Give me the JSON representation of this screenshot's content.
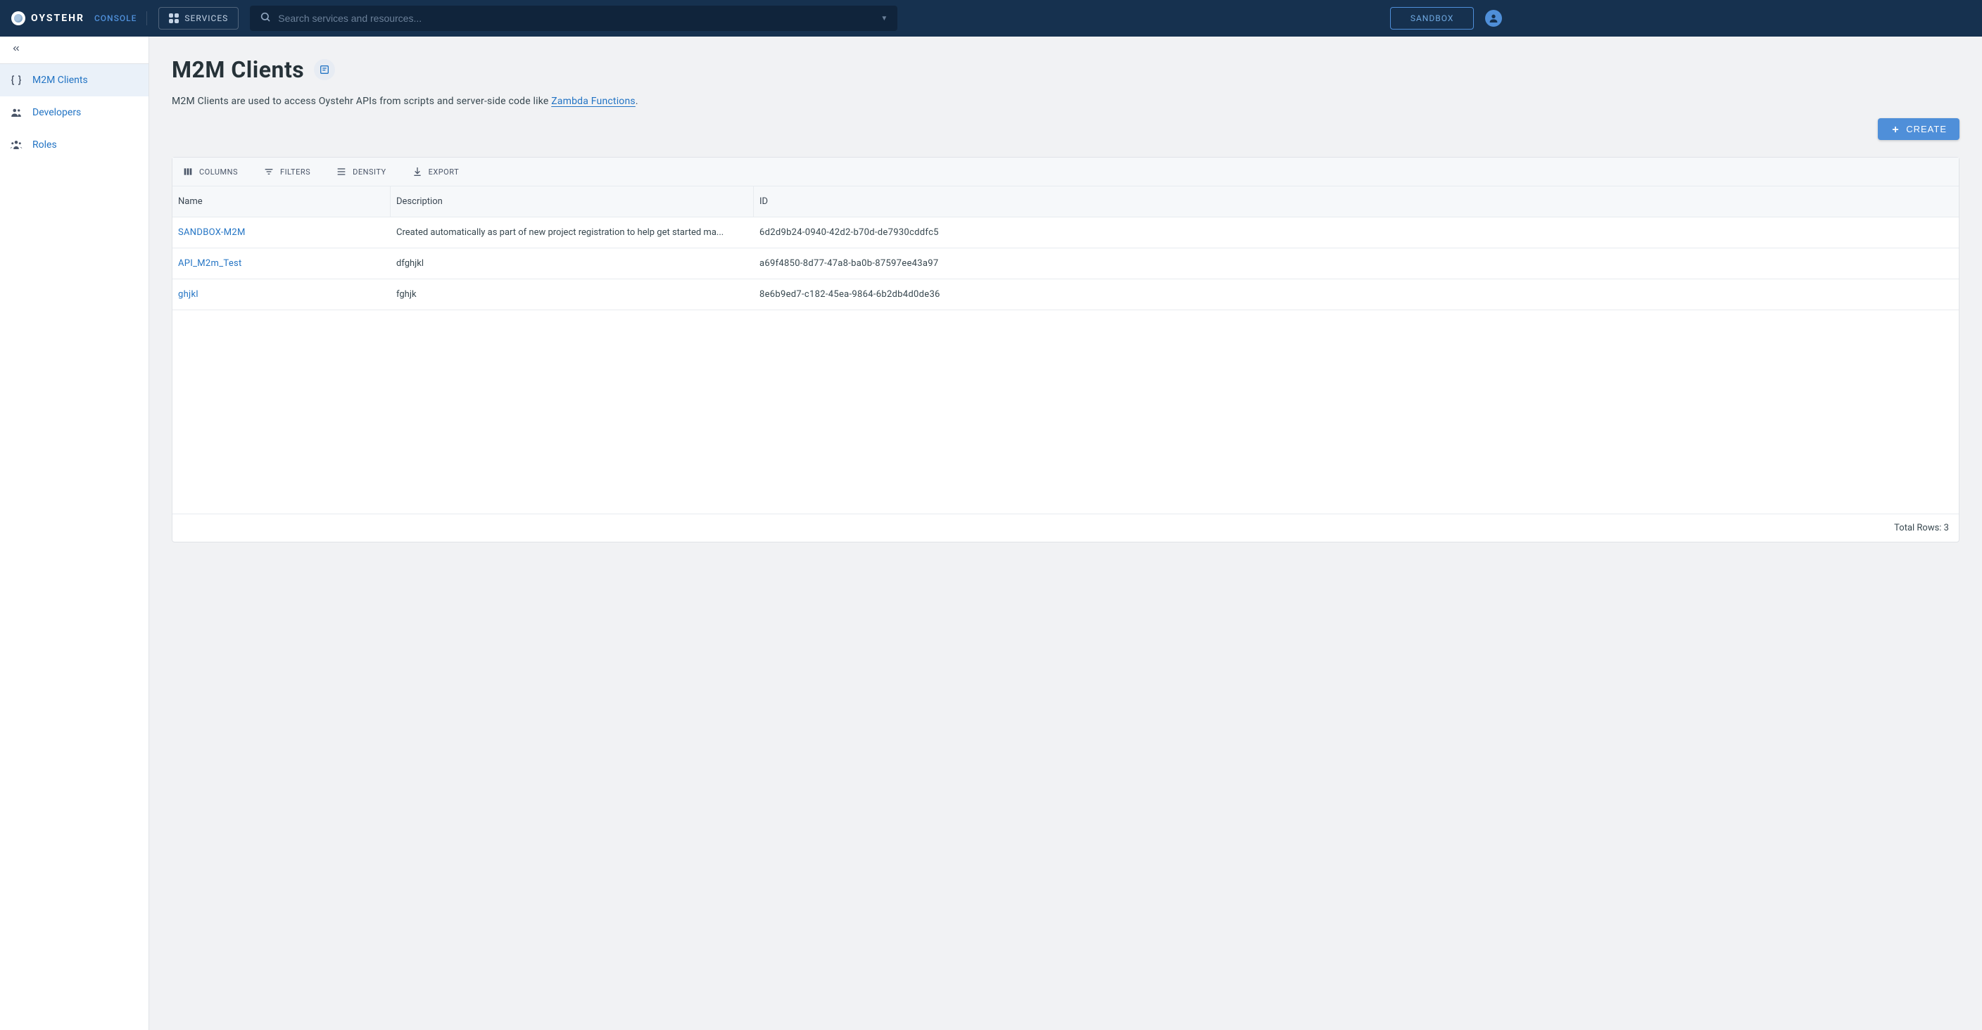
{
  "header": {
    "logo_text": "OYSTEHR",
    "console_label": "CONSOLE",
    "services_label": "SERVICES",
    "search_placeholder": "Search services and resources...",
    "sandbox_label": "SANDBOX"
  },
  "sidebar": {
    "items": [
      {
        "label": "M2M Clients",
        "active": true
      },
      {
        "label": "Developers",
        "active": false
      },
      {
        "label": "Roles",
        "active": false
      }
    ]
  },
  "page": {
    "title": "M2M Clients",
    "description_prefix": "M2M Clients are used to access Oystehr APIs from scripts and server-side code like ",
    "description_link": "Zambda Functions",
    "description_suffix": ".",
    "create_label": "CREATE"
  },
  "table": {
    "toolbar": {
      "columns_label": "COLUMNS",
      "filters_label": "FILTERS",
      "density_label": "DENSITY",
      "export_label": "EXPORT"
    },
    "columns": {
      "name": "Name",
      "description": "Description",
      "id": "ID"
    },
    "rows": [
      {
        "name": "SANDBOX-M2M",
        "description": "Created automatically as part of new project registration to help get started ma...",
        "id": "6d2d9b24-0940-42d2-b70d-de7930cddfc5"
      },
      {
        "name": "API_M2m_Test",
        "description": "dfghjkl",
        "id": "a69f4850-8d77-47a8-ba0b-87597ee43a97"
      },
      {
        "name": "ghjkl",
        "description": "fghjk",
        "id": "8e6b9ed7-c182-45ea-9864-6b2db4d0de36"
      }
    ],
    "total_rows_label": "Total Rows: 3"
  }
}
